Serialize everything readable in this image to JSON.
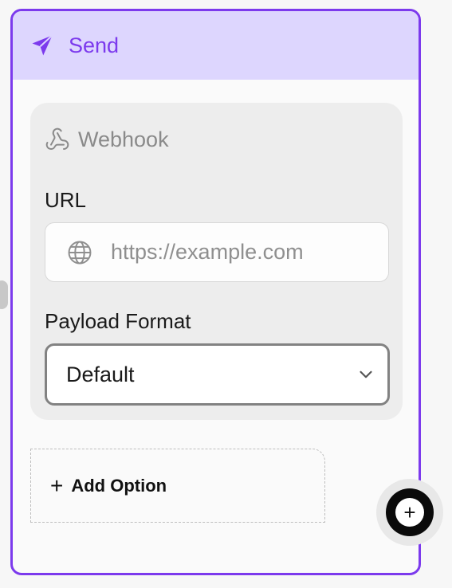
{
  "node": {
    "title": "Send",
    "icon": "paper-plane-icon"
  },
  "action": {
    "type_label": "Webhook",
    "type_icon": "webhook-icon"
  },
  "fields": {
    "url_label": "URL",
    "url_placeholder": "https://example.com",
    "url_icon": "globe-icon",
    "payload_label": "Payload Format",
    "payload_value": "Default",
    "payload_icon": "chevron-down-icon"
  },
  "add_option": {
    "plus": "+",
    "label": "Add Option"
  },
  "add_node": {
    "symbol": "+"
  },
  "colors": {
    "accent": "#7c3aed",
    "header_bg": "#ddd6fe"
  }
}
